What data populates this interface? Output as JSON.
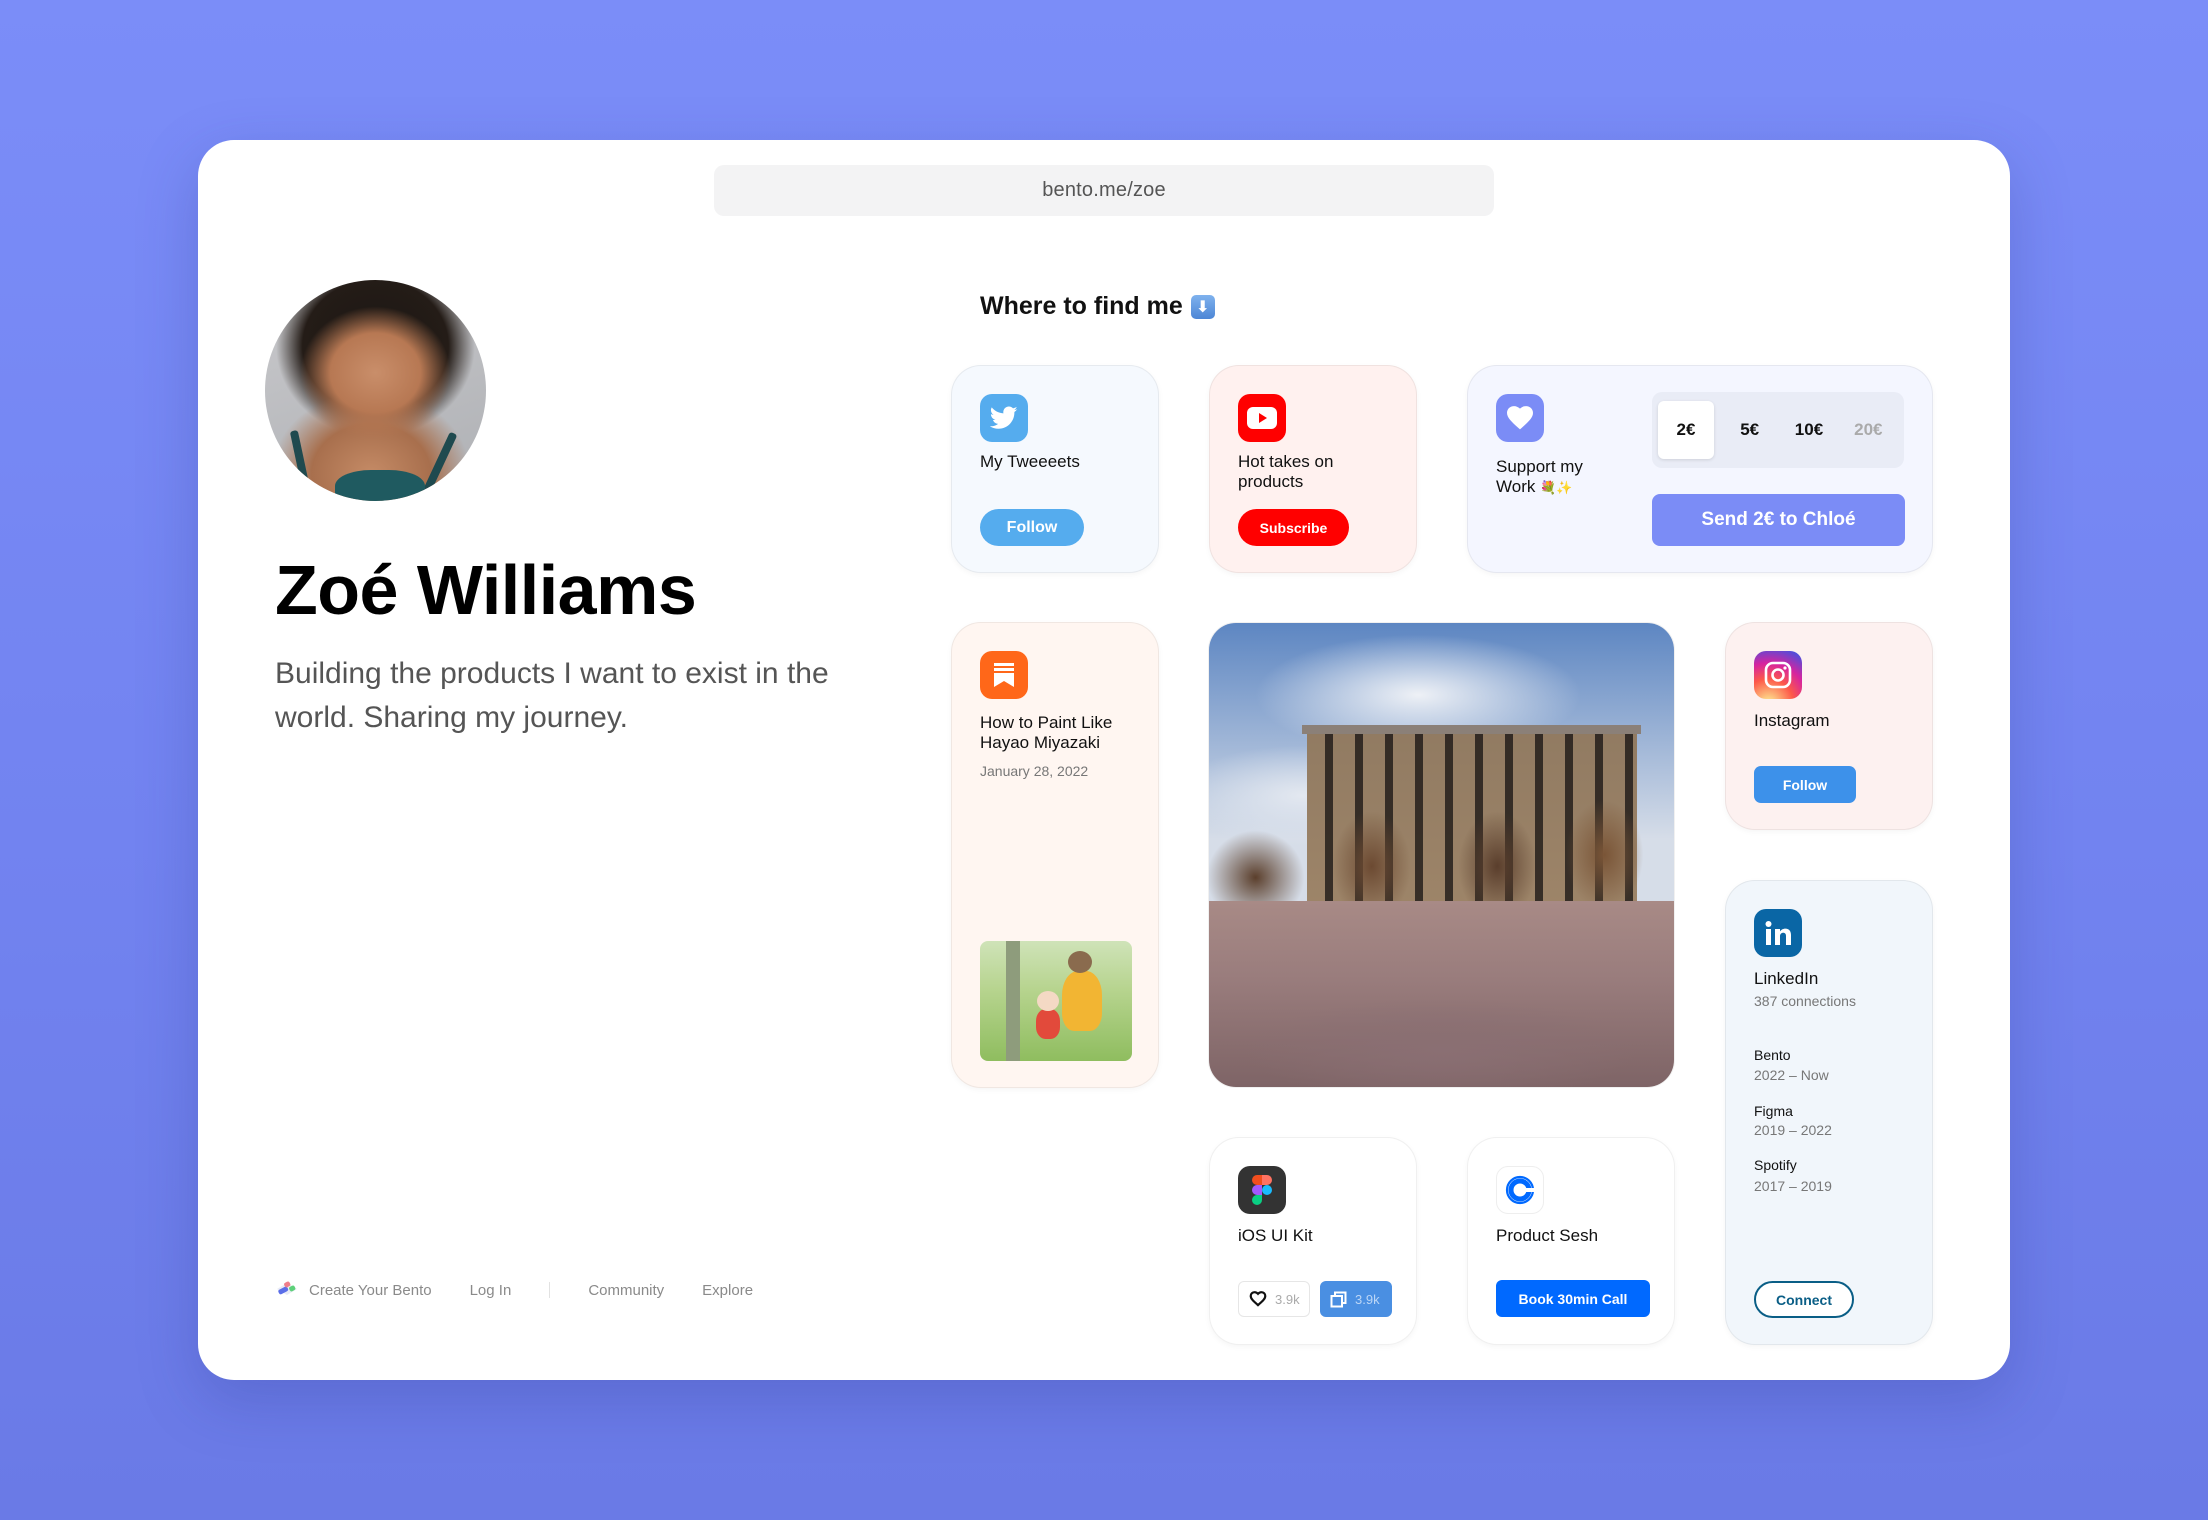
{
  "url": "bento.me/zoe",
  "profile": {
    "name": "Zoé Williams",
    "bio": "Building the products I want to exist in the world. Sharing my journey.",
    "avatar_icon": "profile-photo"
  },
  "section_title": "Where to find me",
  "section_emoji": "⬇",
  "cards": {
    "twitter": {
      "title": "My Tweeeets",
      "button": "Follow",
      "icon": "twitter-bird-icon",
      "color": "#55ACEE"
    },
    "youtube": {
      "title": "Hot takes on products",
      "button": "Subscribe",
      "icon": "youtube-play-icon",
      "color": "#FF0000"
    },
    "support": {
      "title": "Support my Work",
      "title_emoji": "💐✨",
      "icon": "heart-icon",
      "color": "#7B8CF6",
      "amounts": [
        "2€",
        "5€",
        "10€",
        "20€"
      ],
      "selected_amount": "2€",
      "button": "Send 2€ to Chloé"
    },
    "substack": {
      "title": "How to Paint Like Hayao Miyazaki",
      "date": "January 28, 2022",
      "icon": "substack-bookmark-icon",
      "color": "#FF6719"
    },
    "instagram": {
      "title": "Instagram",
      "button": "Follow",
      "icon": "instagram-camera-icon"
    },
    "linkedin": {
      "title": "LinkedIn",
      "subtitle": "387 connections",
      "icon": "linkedin-icon",
      "color": "#0A66C2",
      "experience": [
        {
          "company": "Bento",
          "years": "2022 – Now"
        },
        {
          "company": "Figma",
          "years": "2019 – 2022"
        },
        {
          "company": "Spotify",
          "years": "2017 – 2019"
        }
      ],
      "button": "Connect"
    },
    "figma": {
      "title": "iOS UI Kit",
      "likes": "3.9k",
      "duplicates": "3.9k",
      "icon": "figma-logo-icon"
    },
    "calendly": {
      "title": "Product Sesh",
      "button": "Book 30min Call",
      "icon": "calendly-icon",
      "color": "#0069FF"
    }
  },
  "footer": {
    "create": "Create Your Bento",
    "login": "Log In",
    "community": "Community",
    "explore": "Explore"
  }
}
